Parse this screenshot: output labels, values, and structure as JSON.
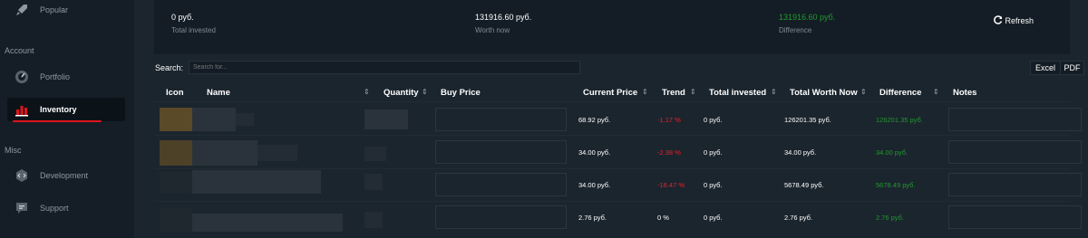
{
  "sidebar": {
    "items": [
      {
        "label": "Popular",
        "icon": "rocket-icon"
      },
      {
        "label": "Portfolio",
        "icon": "dashboard-icon"
      },
      {
        "label": "Inventory",
        "icon": "chart-bar-icon"
      },
      {
        "label": "Development",
        "icon": "code-icon"
      },
      {
        "label": "Support",
        "icon": "chat-icon"
      }
    ],
    "sections": {
      "account": "Account",
      "misc": "Misc"
    },
    "accent": "#e0141c"
  },
  "summary": {
    "total_invested_value": "0 руб.",
    "total_invested_label": "Total invested",
    "worth_now_value": "131916.60 руб.",
    "worth_now_label": "Worth now",
    "difference_value": "131916.60 руб.",
    "difference_label": "Difference",
    "refresh_label": "Refresh"
  },
  "search": {
    "label": "Search:",
    "placeholder": "Search for..."
  },
  "export": {
    "excel": "Excel",
    "pdf": "PDF"
  },
  "table": {
    "headers": {
      "icon": "Icon",
      "name": "Name",
      "quantity": "Quantity",
      "buy_price": "Buy Price",
      "current_price": "Current Price",
      "trend": "Trend",
      "total_invested": "Total invested",
      "total_worth_now": "Total Worth Now",
      "difference": "Difference",
      "notes": "Notes"
    },
    "rows": [
      {
        "current_price": "68.92 руб.",
        "trend": "-1.17 %",
        "total_invested": "0 руб.",
        "total_worth_now": "126201.35 руб.",
        "difference": "126201.35 руб."
      },
      {
        "current_price": "34.00 руб.",
        "trend": "-2.38 %",
        "total_invested": "0 руб.",
        "total_worth_now": "34.00 руб.",
        "difference": "34.00 руб."
      },
      {
        "current_price": "34.00 руб.",
        "trend": "-16.47 %",
        "total_invested": "0 руб.",
        "total_worth_now": "5678.49 руб.",
        "difference": "5678.49 руб."
      },
      {
        "current_price": "2.76 руб.",
        "trend": "0 %",
        "total_invested": "0 руб.",
        "total_worth_now": "2.76 руб.",
        "difference": "2.76 руб."
      }
    ]
  },
  "colors": {
    "positive": "#1f9a2c",
    "negative": "#e0242b",
    "background": "#1b252e",
    "sidebar": "#151e26"
  }
}
